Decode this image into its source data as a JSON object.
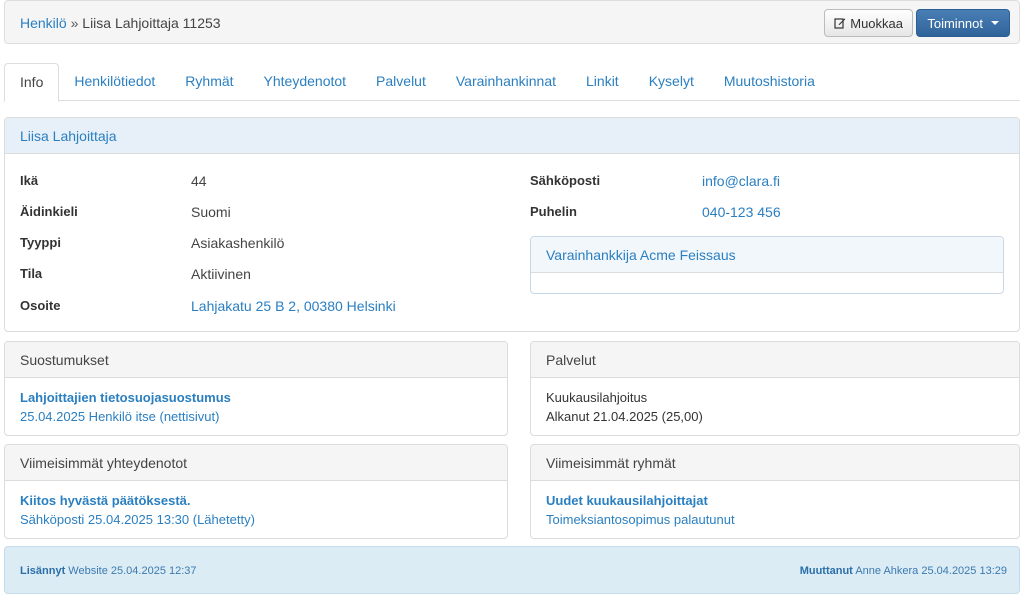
{
  "breadcrumb": {
    "parent": "Henkilö",
    "separator": "»",
    "current": "Liisa Lahjoittaja 11253"
  },
  "toolbar": {
    "edit_label": "Muokkaa",
    "actions_label": "Toiminnot"
  },
  "tabs": [
    "Info",
    "Henkilötiedot",
    "Ryhmät",
    "Yhteydenotot",
    "Palvelut",
    "Varainhankinnat",
    "Linkit",
    "Kyselyt",
    "Muutoshistoria"
  ],
  "person": {
    "name": "Liisa Lahjoittaja",
    "age_label": "Ikä",
    "age": "44",
    "language_label": "Äidinkieli",
    "language": "Suomi",
    "type_label": "Tyyppi",
    "type": "Asiakashenkilö",
    "status_label": "Tila",
    "status": "Aktiivinen",
    "address_label": "Osoite",
    "address": "Lahjakatu 25 B 2, 00380 Helsinki",
    "email_label": "Sähköposti",
    "email": "info@clara.fi",
    "phone_label": "Puhelin",
    "phone": "040-123 456",
    "fundraiser_title": "Varainhankkija Acme Feissaus"
  },
  "consents": {
    "title": "Suostumukset",
    "item_title": "Lahjoittajien tietosuojasuostumus",
    "item_detail": "25.04.2025 Henkilö itse (nettisivut)"
  },
  "services": {
    "title": "Palvelut",
    "line1": "Kuukausilahjoitus",
    "line2": "Alkanut 21.04.2025 (25,00)"
  },
  "contacts": {
    "title": "Viimeisimmät yhteydenotot",
    "item_title": "Kiitos hyvästä päätöksestä.",
    "item_detail": "Sähköposti 25.04.2025 13:30 (Lähetetty)"
  },
  "groups": {
    "title": "Viimeisimmät ryhmät",
    "item_title": "Uudet kuukausilahjoittajat",
    "item_detail": "Toimeksiantosopimus palautunut"
  },
  "footer": {
    "added_label": "Lisännyt",
    "added_value": "Website 25.04.2025 12:37",
    "modified_label": "Muuttanut",
    "modified_value": "Anne Ahkera 25.04.2025 13:29"
  }
}
